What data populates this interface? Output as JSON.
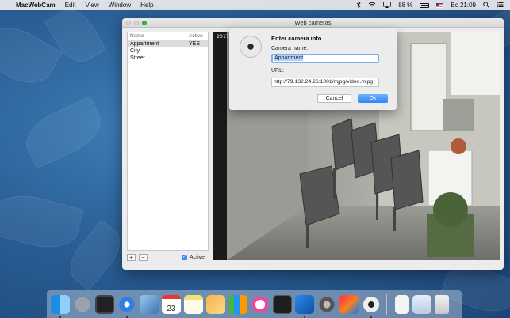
{
  "menubar": {
    "app_name": "MacWebCam",
    "items": [
      "Edit",
      "View",
      "Window",
      "Help"
    ],
    "battery_percent": "88 %",
    "clock": "Вс 21:09"
  },
  "window": {
    "title": "Web cameras",
    "list": {
      "col_name": "Name",
      "col_active": "Active",
      "rows": [
        {
          "name": "Appartment",
          "active": "YES"
        },
        {
          "name": "City",
          "active": ""
        },
        {
          "name": "Street",
          "active": ""
        }
      ]
    },
    "add_label": "+",
    "remove_label": "−",
    "active_label": "Active",
    "video_timestamp": "2017-"
  },
  "dialog": {
    "title": "Enter camera info",
    "name_label": "Camera name:",
    "name_value": "Appartment",
    "url_label": "URL:",
    "url_value": "http://79.132.24.26:1001/mjpg/video.mjpg",
    "cancel_label": "Cancel",
    "ok_label": "Ok"
  },
  "dock": {
    "calendar_day": "23",
    "icons": [
      "finder-icon",
      "launchpad-icon",
      "mission-control-icon",
      "safari-icon",
      "preview-icon",
      "calendar-icon",
      "notes-icon",
      "pages-icon",
      "numbers-icon",
      "itunes-icon",
      "terminal-icon",
      "xcode-icon",
      "system-preferences-icon",
      "intellij-icon",
      "webcam-app-icon",
      "document-icon",
      "downloads-icon",
      "trash-icon"
    ]
  }
}
